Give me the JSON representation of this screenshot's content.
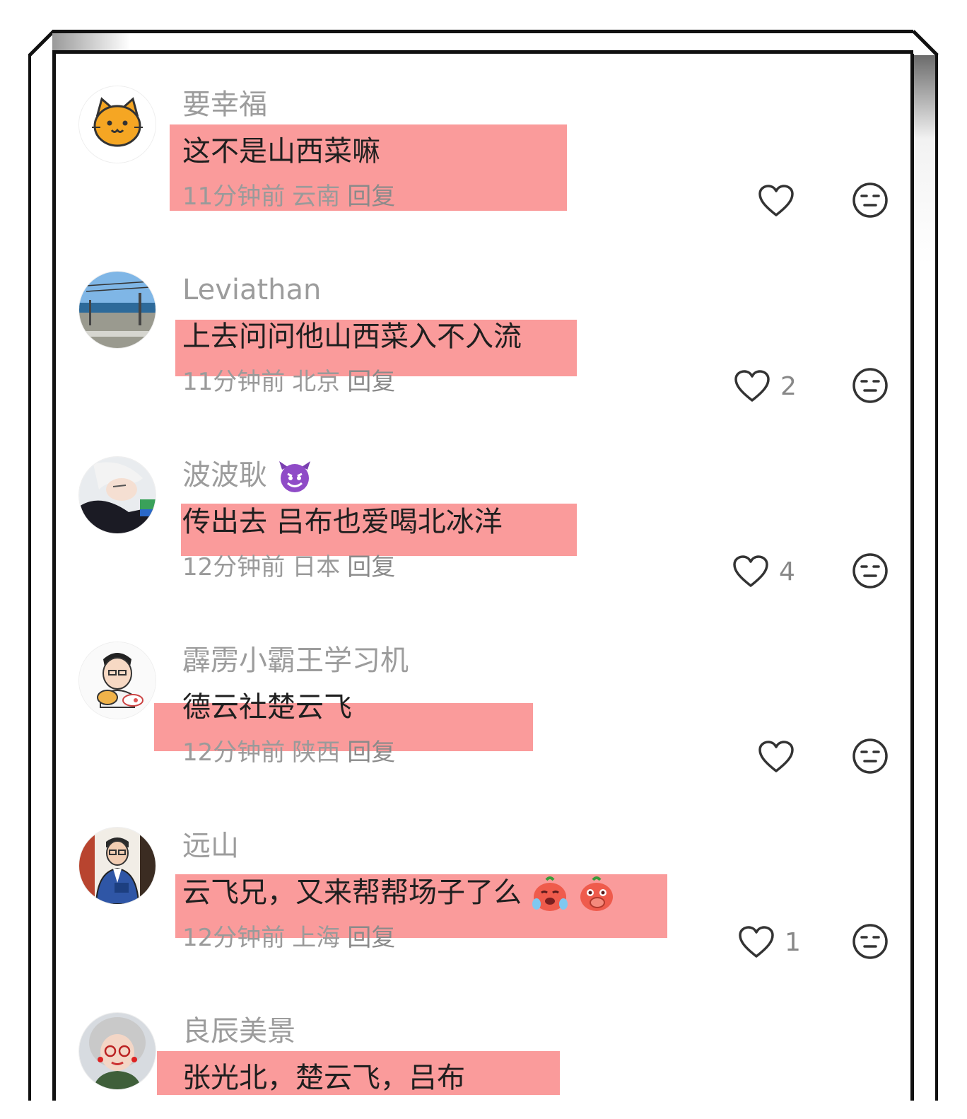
{
  "comments": [
    {
      "username": "要幸福",
      "text": "这不是山西菜嘛",
      "time": "11分钟前",
      "location": "云南",
      "reply": "回复",
      "likes": "",
      "avatar": "cat-avatar-icon"
    },
    {
      "username": "Leviathan",
      "text": "上去问问他山西菜入不入流",
      "time": "11分钟前",
      "location": "北京",
      "reply": "回复",
      "likes": "2",
      "avatar": "seaside-photo-avatar"
    },
    {
      "username": "波波耿",
      "text": "传出去 吕布也爱喝北冰洋",
      "time": "12分钟前",
      "location": "日本",
      "reply": "回复",
      "likes": "4",
      "avatar": "anime-character-avatar"
    },
    {
      "username": "霹雳小霸王学习机",
      "text": "德云社楚云飞",
      "time": "12分钟前",
      "location": "陕西",
      "reply": "回复",
      "likes": "",
      "avatar": "cartoon-man-avatar"
    },
    {
      "username": "远山",
      "text": "云飞兄，又来帮帮场子了么",
      "time": "12分钟前",
      "location": "上海",
      "reply": "回复",
      "likes": "1",
      "avatar": "cartoon-suit-man-avatar"
    },
    {
      "username": "良辰美景",
      "text": "张光北，楚云飞，吕布",
      "time": "",
      "location": "",
      "reply": "",
      "likes": "",
      "avatar": "grandma-avatar"
    }
  ],
  "colors": {
    "highlight": "#f76c6c",
    "username": "#9c9c9c",
    "text": "#1f1f1f",
    "meta": "#9a9a9a"
  },
  "icons": {
    "like": "heart-outline-icon",
    "dislike": "neutral-face-icon",
    "devil": "purple-devil-emoji",
    "cry": "crying-emoji",
    "shy": "covering-mouth-emoji"
  }
}
